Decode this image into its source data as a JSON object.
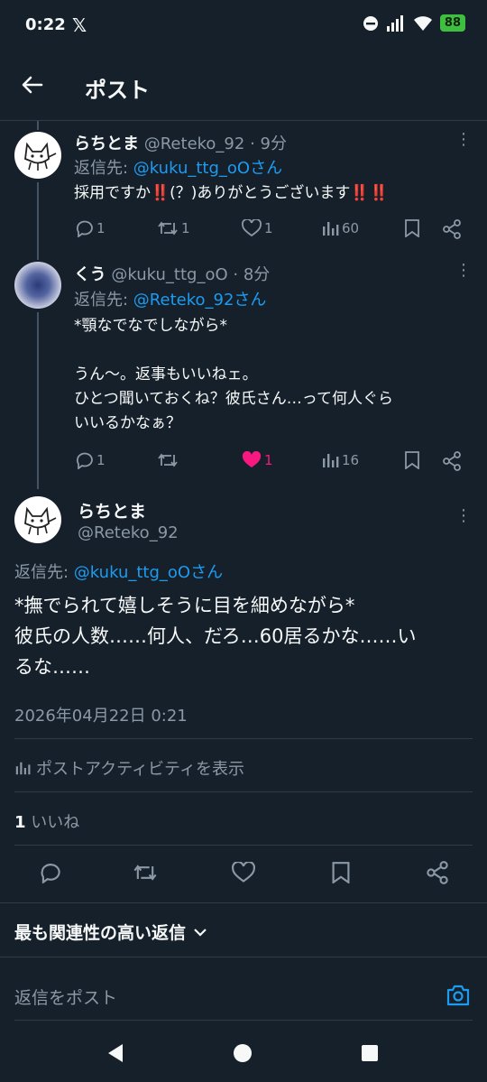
{
  "status_bar": {
    "time": "0:22",
    "app_logo": "𝕏",
    "battery": "88"
  },
  "header": {
    "title": "ポスト"
  },
  "tweets": [
    {
      "name": "らちとま",
      "handle": "@Reteko_92",
      "time": "· 9分",
      "reply_prefix": "返信先: ",
      "reply_to": "@kuku_ttg_oOさん",
      "text_lines": [
        "採用ですか‼️(？)ありがとうございます‼️‼️"
      ],
      "replies": "1",
      "retweets": "1",
      "likes": "1",
      "views": "60"
    },
    {
      "name": "くう",
      "handle": "@kuku_ttg_oO",
      "time": "· 8分",
      "reply_prefix": "返信先: ",
      "reply_to": "@Reteko_92さん",
      "text_lines": [
        "*顎なでなでしながら*",
        "",
        "うん〜。返事もいいねェ。",
        "ひとつ聞いておくね？彼氏さん…って何人ぐら",
        "いいるかなぁ？"
      ],
      "replies": "1",
      "retweets": "",
      "likes": "1",
      "views": "16"
    }
  ],
  "main_tweet": {
    "name": "らちとま",
    "handle": "@Reteko_92",
    "reply_prefix": "返信先: ",
    "reply_to": "@kuku_ttg_oOさん",
    "text_lines": [
      "*撫でられて嬉しそうに目を細めながら*",
      "彼氏の人数……何人、だろ…60居るかな……い",
      "るな……"
    ],
    "timestamp": "2026年04月22日 0:21",
    "activity": "ポストアクティビティを表示",
    "likes_count": "1",
    "likes_label": " いいね"
  },
  "sort": {
    "label": "最も関連性の高い返信"
  },
  "reply_box": {
    "placeholder": "返信をポスト"
  },
  "colors": {
    "background": "#15202b",
    "accent": "#1d9bf0",
    "like": "#f91880",
    "muted": "#8b98a5"
  }
}
